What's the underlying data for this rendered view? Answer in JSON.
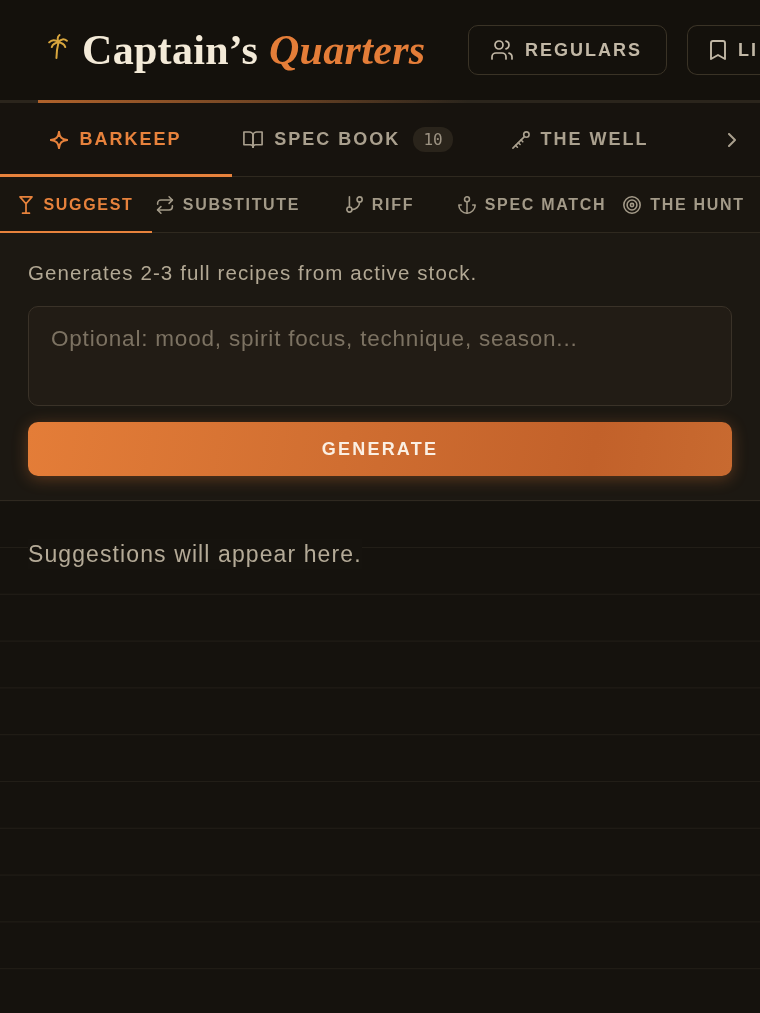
{
  "header": {
    "title": "Captain’s *Quarters*",
    "nav_buttons": [
      {
        "label": "REGULARS"
      },
      {
        "label": "LI"
      }
    ]
  },
  "tabs": [
    {
      "label": "BARKEEP",
      "selected": true
    },
    {
      "label": "SPEC BOOK",
      "badge": "10",
      "selected": false
    },
    {
      "label": "THE WELL",
      "selected": false
    }
  ],
  "modes": [
    {
      "label": "SUGGEST",
      "selected": true
    },
    {
      "label": "SUBSTITUTE",
      "selected": false
    },
    {
      "label": "RIFF",
      "selected": false
    },
    {
      "label": "SPEC MATCH",
      "selected": false
    },
    {
      "label": "THE HUNT",
      "selected": false
    }
  ],
  "suggest_panel": {
    "description": "Generates 2-3 full recipes from active stock.",
    "prompt_field": {
      "placeholder": "Optional: mood, spirit focus, technique, season..."
    },
    "generate_button": "GENERATE"
  },
  "results": {
    "empty_text": "Suggestions will appear here."
  }
}
